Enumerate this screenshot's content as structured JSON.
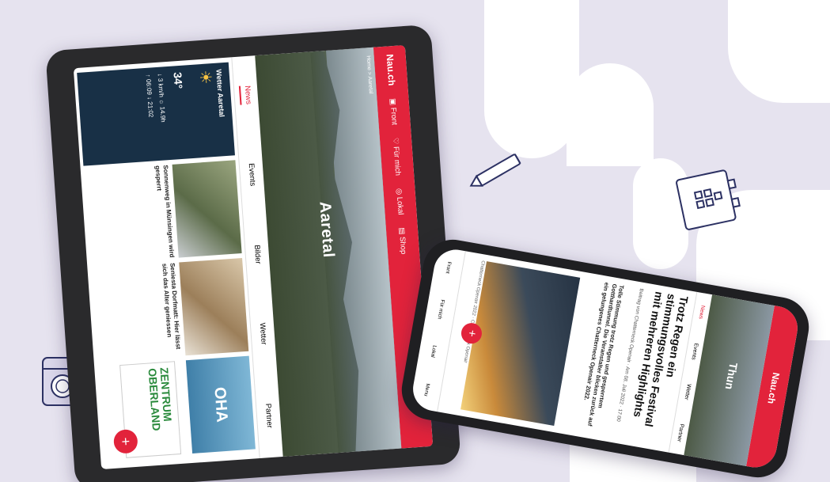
{
  "colors": {
    "background": "#e6e3ef",
    "brand_red": "#e2233b",
    "weather_panel": "#183046",
    "device_frame": "#2a2a2c"
  },
  "tablet": {
    "logo": "Nau.ch",
    "nav": [
      {
        "icon": "newspaper-icon",
        "label": "Front"
      },
      {
        "icon": "heart-icon",
        "label": "Für mich"
      },
      {
        "icon": "location-icon",
        "label": "Lokal"
      },
      {
        "icon": "shop-icon",
        "label": "Shop"
      }
    ],
    "breadcrumb": "Home > Aaretal",
    "hero_title": "Aaretal",
    "tabs": [
      "News",
      "Events",
      "Bilder",
      "Wetter",
      "Partner"
    ],
    "weather": {
      "title": "Wetter Aaretal",
      "temp": "34°",
      "wind": "3 km/h",
      "sunshine": "14.9h",
      "sunrise": "06:09",
      "sunset": "21:02"
    },
    "articles": [
      {
        "text": "Sonnenweg in Münsingen wird gesperrt"
      },
      {
        "text": "Seniesta Dorfmatt: Hier lässt sich das Alter geniessen"
      },
      {
        "text": "OHA"
      }
    ],
    "ad": {
      "line1": "ZENTRUM",
      "line2": "OBERLAND"
    },
    "fab": "+"
  },
  "phone": {
    "logo": "Nau.ch",
    "hero_title": "Thun",
    "tabs": [
      "News",
      "Events",
      "Wetter",
      "Partner"
    ],
    "headline": "Trotz Regen ein stimmungsvolles Festival mit mehreren Highlights",
    "meta": "Beitrag von Chatterneck Openair · Am 08. Juli 2022 · 17:00",
    "summary": "Tolle Stimmung trotz Regen und gesperrtem Gotthardtunnel. Die Veranstalter blicken zurück auf ein gelungenes Chatterneck Openair 2022.",
    "caption": "Chatterneck Openair 2022 · Chatterneck Openair",
    "nav": [
      "Front",
      "Für mich",
      "Lokal",
      "Menu"
    ],
    "fab": "+"
  }
}
